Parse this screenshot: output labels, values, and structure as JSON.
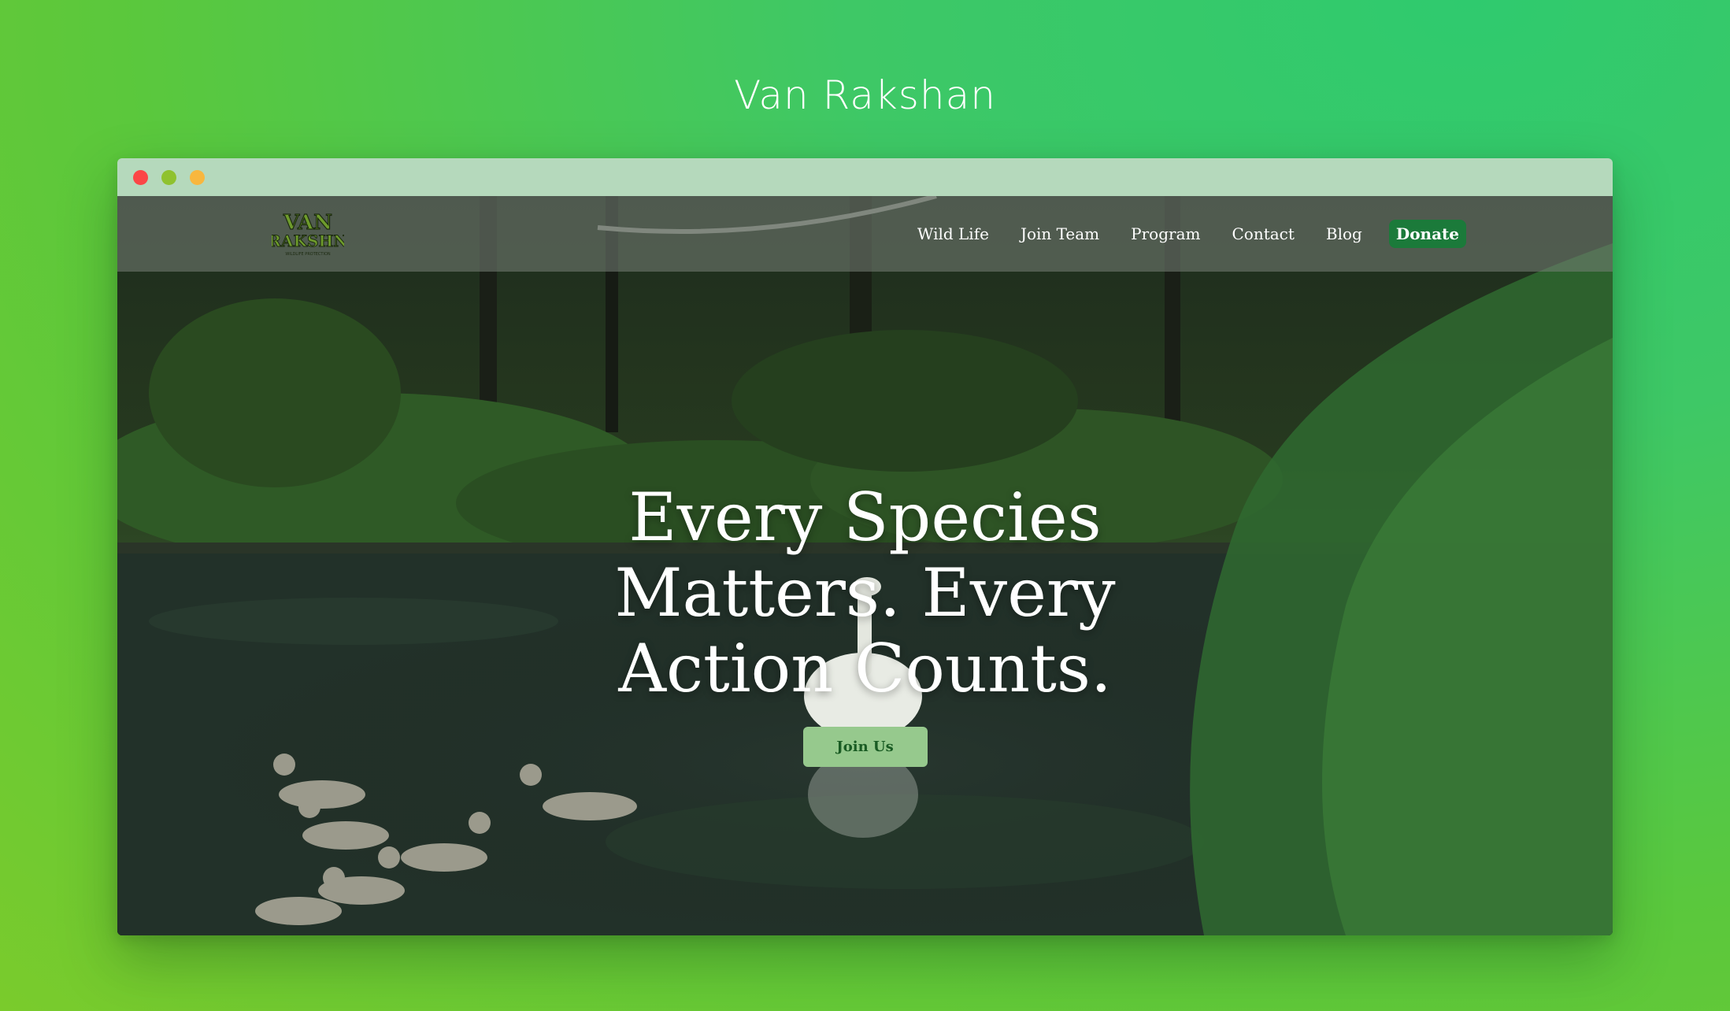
{
  "page": {
    "heading": "Van Rakshan"
  },
  "browser": {
    "traffic_lights": [
      "close",
      "minimize",
      "maximize"
    ]
  },
  "site": {
    "logo": {
      "line1": "VAN",
      "line2": "RAKSHN",
      "tagline": "WILDLIFE PROTECTION"
    },
    "nav": {
      "links": [
        "Wild Life",
        "Join Team",
        "Program",
        "Contact",
        "Blog"
      ],
      "donate": "Donate"
    },
    "hero": {
      "title": "Every Species Matters. Every Action Counts.",
      "cta": "Join Us"
    }
  },
  "colors": {
    "accent": "#1b7a3a",
    "cta_bg": "#96c98d",
    "cta_text": "#1a5c24",
    "titlebar": "#b5d9bc"
  }
}
